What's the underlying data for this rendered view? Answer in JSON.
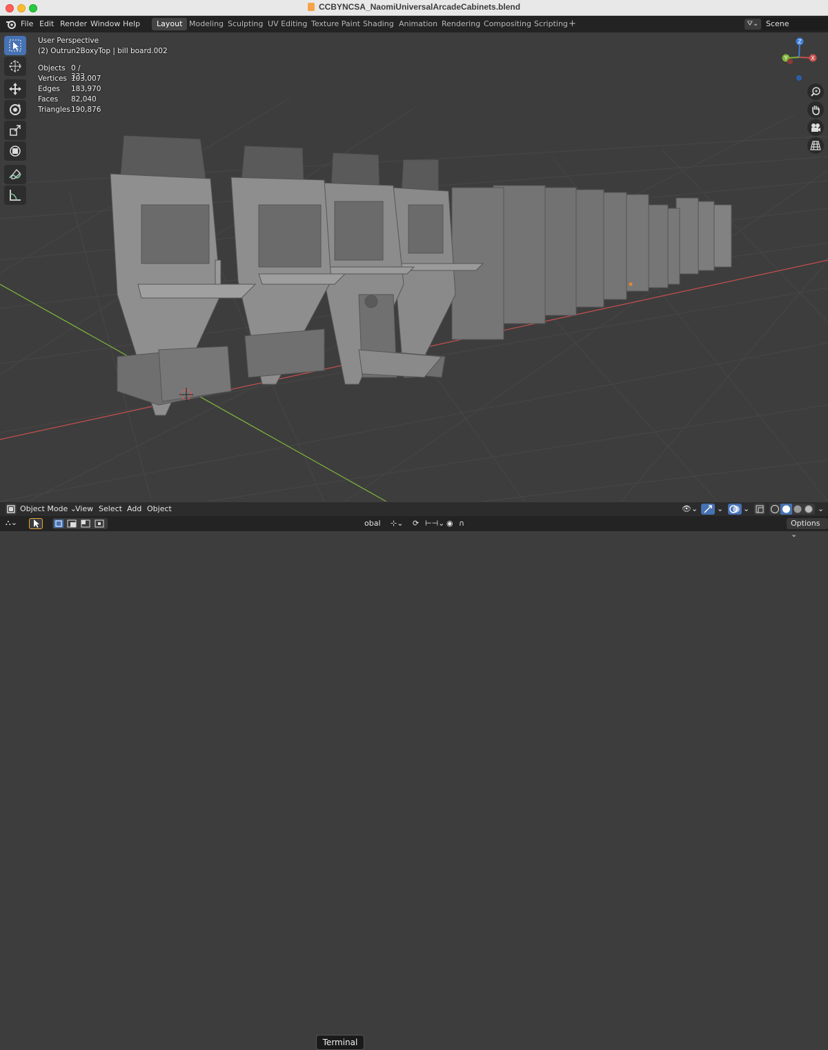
{
  "window": {
    "title": "CCBYNCSA_NaomiUniversalArcadeCabinets.blend"
  },
  "menu": [
    "File",
    "Edit",
    "Render",
    "Window",
    "Help"
  ],
  "workspaces": [
    "Layout",
    "Modeling",
    "Sculpting",
    "UV Editing",
    "Texture Paint",
    "Shading",
    "Animation",
    "Rendering",
    "Compositing",
    "Scripting"
  ],
  "add_workspace": "+",
  "scene": {
    "label": "Scene"
  },
  "viewport": {
    "perspective": "User Perspective",
    "active_object": "(2) Outrun2BoxyTop | bill board.002",
    "stats": [
      {
        "label": "Objects",
        "value": "0 / 333"
      },
      {
        "label": "Vertices",
        "value": "103,007"
      },
      {
        "label": "Edges",
        "value": "183,970"
      },
      {
        "label": "Faces",
        "value": "82,040"
      },
      {
        "label": "Triangles",
        "value": "190,876"
      }
    ],
    "gizmo_axes": {
      "z": "Z",
      "y": "Y",
      "x": "X"
    }
  },
  "tools": [
    "select-box",
    "cursor",
    "move",
    "rotate",
    "scale",
    "transform",
    "annotate",
    "measure"
  ],
  "header": {
    "mode": "Object Mode",
    "items": [
      "View",
      "Select",
      "Add",
      "Object"
    ]
  },
  "status": {
    "terminal": "Terminal",
    "orientation_partial": "obal",
    "options": "Options"
  },
  "colors": {
    "accent": "#4772b3",
    "x_axis": "#c8504e",
    "y_axis": "#7fb53b",
    "z_axis": "#3f7fd9"
  }
}
